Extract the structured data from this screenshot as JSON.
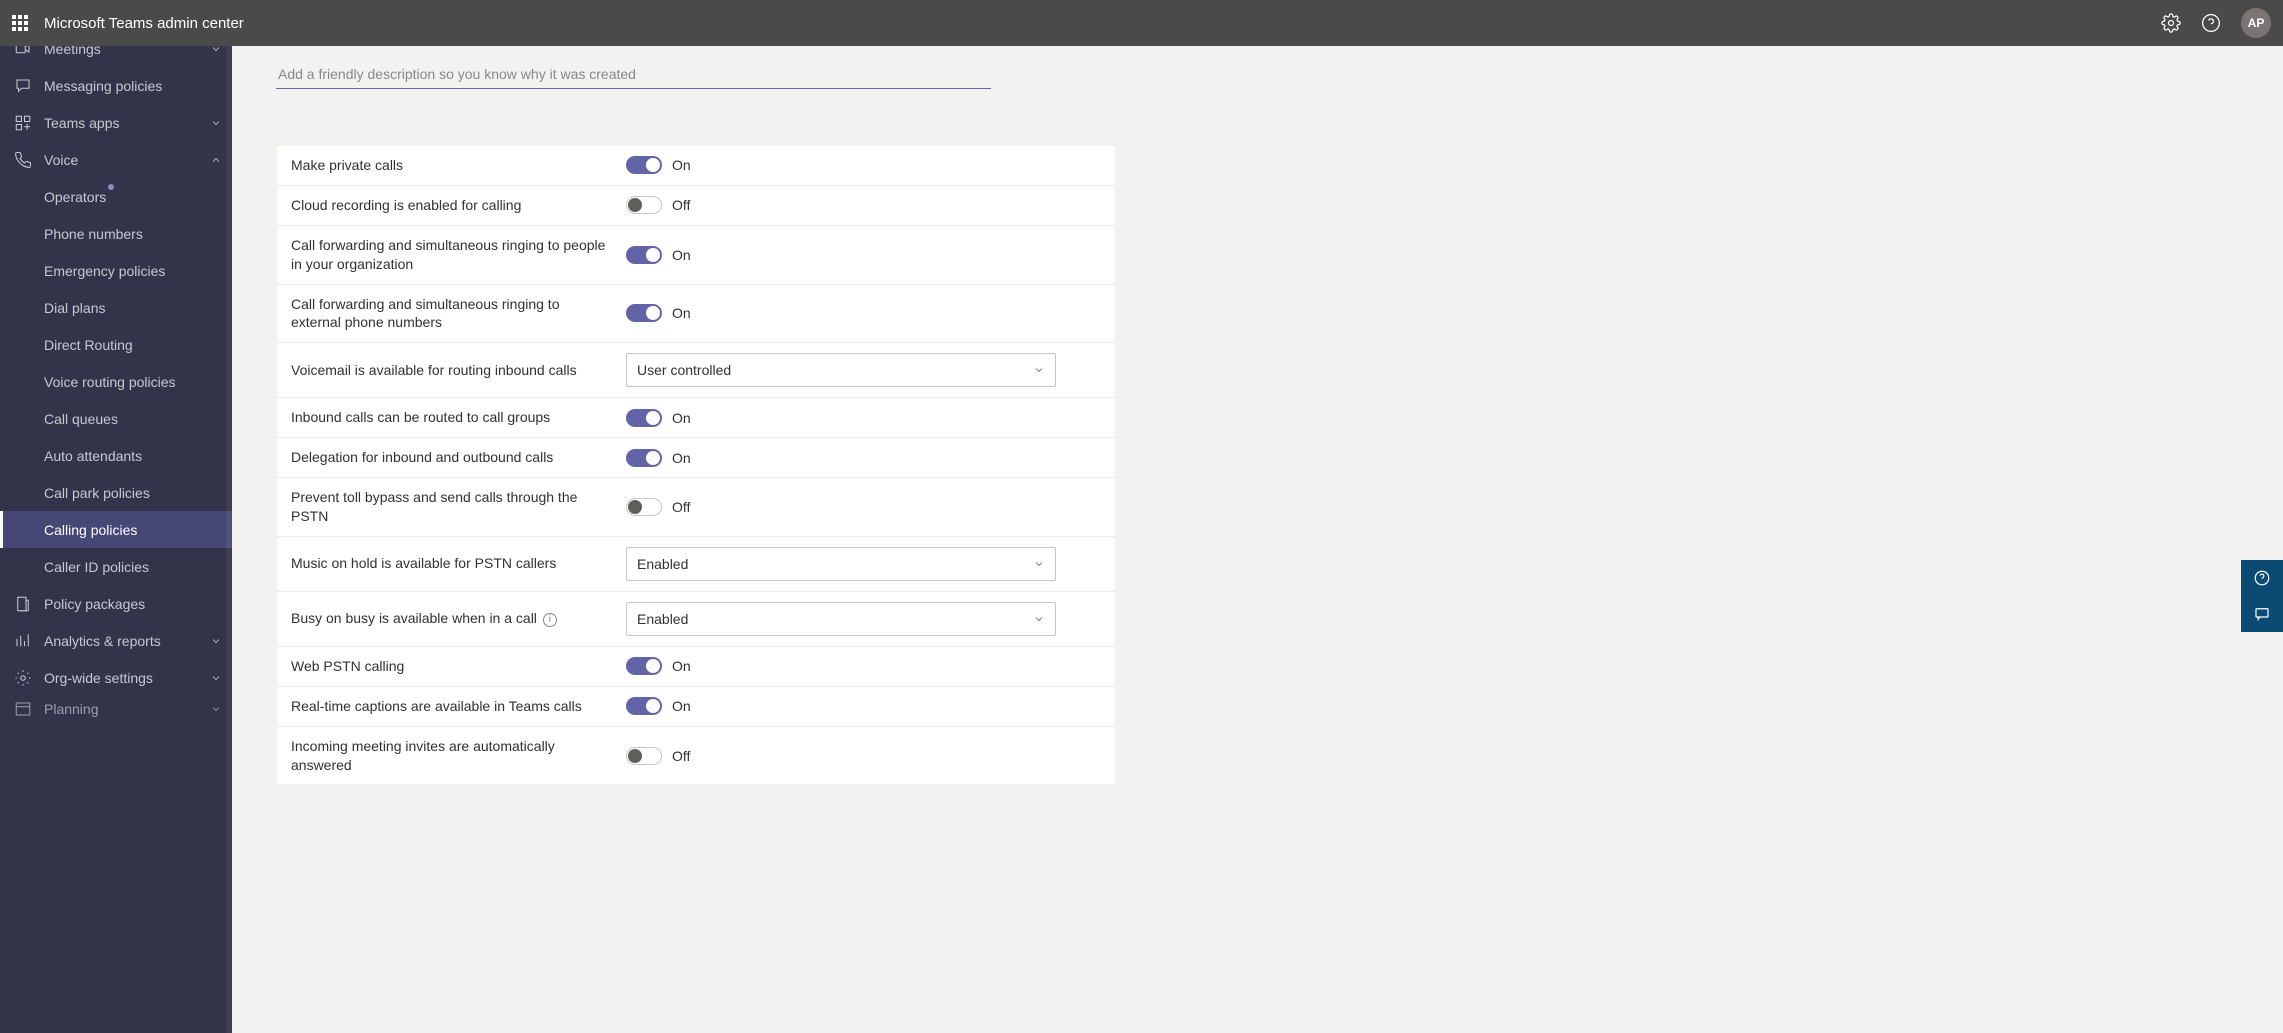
{
  "header": {
    "app_title": "Microsoft Teams admin center",
    "avatar_initials": "AP"
  },
  "sidebar": {
    "items": [
      {
        "label": "Meetings",
        "expandable": true,
        "state": "collapsed",
        "cutoff": true
      },
      {
        "label": "Messaging policies"
      },
      {
        "label": "Teams apps",
        "expandable": true,
        "state": "collapsed"
      },
      {
        "label": "Voice",
        "expandable": true,
        "state": "expanded",
        "children": [
          {
            "label": "Operators",
            "badge": true
          },
          {
            "label": "Phone numbers"
          },
          {
            "label": "Emergency policies"
          },
          {
            "label": "Dial plans"
          },
          {
            "label": "Direct Routing"
          },
          {
            "label": "Voice routing policies"
          },
          {
            "label": "Call queues"
          },
          {
            "label": "Auto attendants"
          },
          {
            "label": "Call park policies"
          },
          {
            "label": "Calling policies",
            "active": true
          },
          {
            "label": "Caller ID policies"
          }
        ]
      },
      {
        "label": "Policy packages"
      },
      {
        "label": "Analytics & reports",
        "expandable": true,
        "state": "collapsed"
      },
      {
        "label": "Org-wide settings",
        "expandable": true,
        "state": "collapsed"
      },
      {
        "label": "Planning",
        "expandable": true,
        "state": "collapsed",
        "cutoff_bottom": true
      }
    ]
  },
  "main": {
    "description_placeholder": "Add a friendly description so you know why it was created",
    "on_label": "On",
    "off_label": "Off",
    "settings": [
      {
        "type": "toggle",
        "label": "Make private calls",
        "value": true
      },
      {
        "type": "toggle",
        "label": "Cloud recording is enabled for calling",
        "value": false
      },
      {
        "type": "toggle",
        "label": "Call forwarding and simultaneous ringing to people in your organization",
        "value": true
      },
      {
        "type": "toggle",
        "label": "Call forwarding and simultaneous ringing to external phone numbers",
        "value": true
      },
      {
        "type": "select",
        "label": "Voicemail is available for routing inbound calls",
        "value": "User controlled"
      },
      {
        "type": "toggle",
        "label": "Inbound calls can be routed to call groups",
        "value": true
      },
      {
        "type": "toggle",
        "label": "Delegation for inbound and outbound calls",
        "value": true
      },
      {
        "type": "toggle",
        "label": "Prevent toll bypass and send calls through the PSTN",
        "value": false
      },
      {
        "type": "select",
        "label": "Music on hold is available for PSTN callers",
        "value": "Enabled"
      },
      {
        "type": "select",
        "label": "Busy on busy is available when in a call",
        "value": "Enabled",
        "info": true
      },
      {
        "type": "toggle",
        "label": "Web PSTN calling",
        "value": true
      },
      {
        "type": "toggle",
        "label": "Real-time captions are available in Teams calls",
        "value": true
      },
      {
        "type": "toggle",
        "label": "Incoming meeting invites are automatically answered",
        "value": false
      }
    ]
  }
}
